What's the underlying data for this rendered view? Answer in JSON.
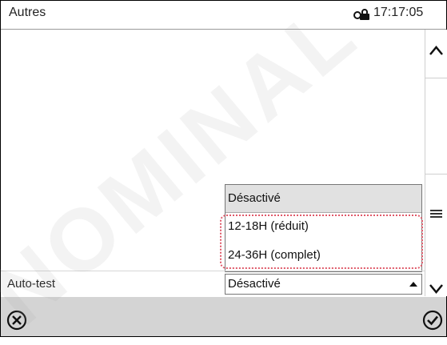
{
  "header": {
    "title": "Autres",
    "time": "17:17:05",
    "lock_icon": "lock-icon"
  },
  "scrollbar": {
    "up_icon": "chevron-up-icon",
    "menu_icon": "hamburger-icon",
    "down_icon": "chevron-down-icon"
  },
  "setting": {
    "label": "Auto-test",
    "value": "Désactivé",
    "options": [
      "Désactivé",
      "12-18H (réduit)",
      "24-36H (complet)"
    ]
  },
  "footer": {
    "cancel_icon": "cancel-icon",
    "confirm_icon": "confirm-icon"
  },
  "watermark": "NOMINAL",
  "colors": {
    "highlight": "#e05a6a",
    "footer_bg": "#d4d4d4",
    "selected_option_bg": "#e1e1e1"
  }
}
